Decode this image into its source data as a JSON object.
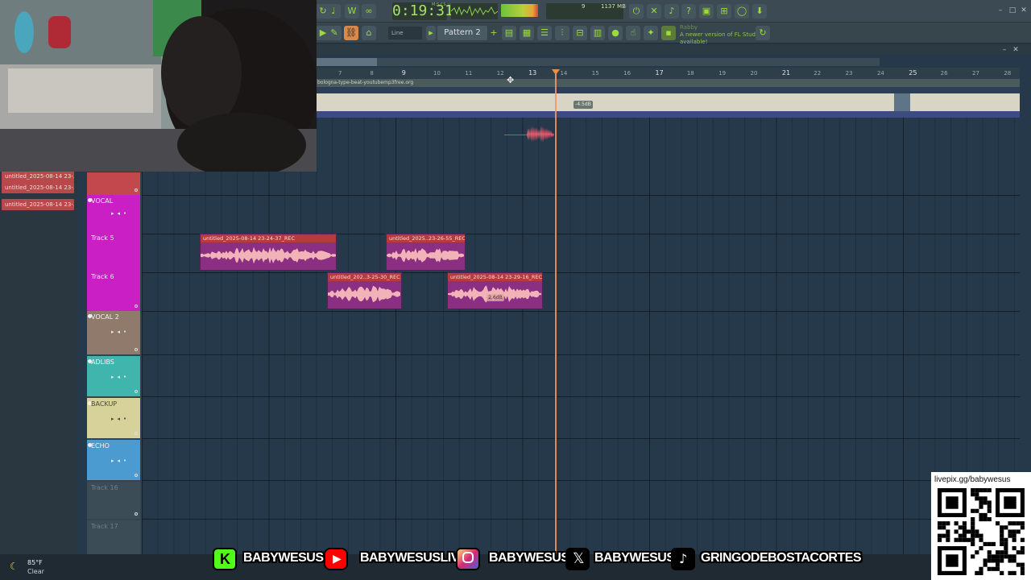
{
  "toolbar": {
    "time": "0:19:31",
    "time_unit": "M:S:CS",
    "cpu": "9",
    "memory": "1137 MB",
    "memory_sub": "1",
    "mode": "Line",
    "pattern": "Pattern 2",
    "news_author": "Rabby",
    "news_text": "A newer version of FL Studio is available!"
  },
  "ruler": {
    "marks": [
      "7",
      "8",
      "9",
      "10",
      "11",
      "12",
      "13",
      "14",
      "15",
      "16",
      "17",
      "18",
      "19",
      "20",
      "21",
      "22",
      "23",
      "24",
      "25",
      "26",
      "27",
      "28"
    ]
  },
  "audio_track": {
    "title": "bologna-type-beat-youtubemp3free.org",
    "db": "-4.5dB"
  },
  "browser": {
    "items": [
      "untitled_2025-08-14 23-...",
      "untitled_2025-08-14 23-...",
      "untitled_2025-08-14 23-..."
    ]
  },
  "tracks": {
    "vocal": "VOCAL",
    "track5": "Track 5",
    "track6": "Track 6",
    "vocal2": "VOCAL 2",
    "adlibs": "ADLIBS",
    "backup": "BACKUP",
    "echo": "ECHO",
    "track16": "Track 16",
    "track17": "Track 17"
  },
  "clips": {
    "c1": "untitled_2025-08-14 23-24-37_REC",
    "c2": "untitled_2025..23-26-55_REC",
    "c3": "untitled_202..3-25-30_REC",
    "c4": "untitled_2025-08-14 23-29-16_REC",
    "c4_db": "2.6dB"
  },
  "colors": {
    "vocal": "#c91fc4",
    "vocal2": "#8f7a6c",
    "adlibs": "#3fb5ae",
    "backup": "#d7d29a",
    "echo": "#4b9ad0",
    "clip": "#8a2f82",
    "clip_title": "#b53c3c",
    "playhead": "#f09666"
  },
  "weather": {
    "temp": "85°F",
    "desc": "Clear",
    "icon": "moon-icon"
  },
  "socials": [
    {
      "platform": "kick",
      "handle": "BABYWESUS"
    },
    {
      "platform": "youtube",
      "handle": "BABYWESUSLIVE"
    },
    {
      "platform": "instagram",
      "handle": "BABYWESUS"
    },
    {
      "platform": "x",
      "handle": "BABYWESUS"
    },
    {
      "platform": "tiktok",
      "handle": "GRINGODEBOSTACORTES"
    }
  ],
  "qr": {
    "label": "livepix.gg/babywesus"
  }
}
